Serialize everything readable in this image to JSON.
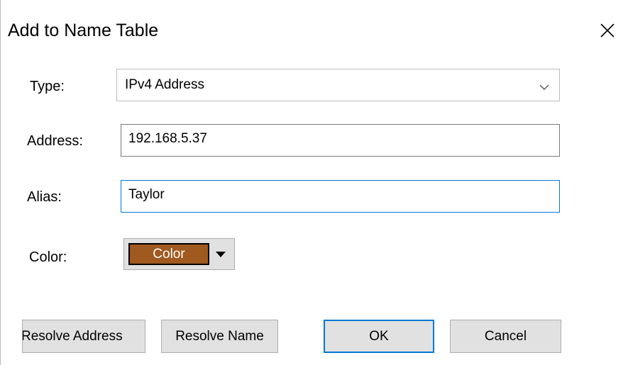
{
  "dialog": {
    "title": "Add to Name Table"
  },
  "fields": {
    "type_label": "Type:",
    "type_value": "IPv4 Address",
    "address_label": "Address:",
    "address_value": "192.168.5.37",
    "alias_label": "Alias:",
    "alias_value": "Taylor",
    "color_label": "Color:",
    "color_swatch_label": "Color"
  },
  "buttons": {
    "resolve_address": "Resolve Address",
    "resolve_name": "Resolve Name",
    "ok": "OK",
    "cancel": "Cancel"
  },
  "icons": {
    "close": "close-icon",
    "type_dropdown": "chevron-down-icon",
    "color_dropdown": "triangle-down-icon"
  },
  "colors": {
    "swatch": "#a0591f",
    "focus_accent": "#0078d7",
    "button_face": "#e1e1e1"
  }
}
